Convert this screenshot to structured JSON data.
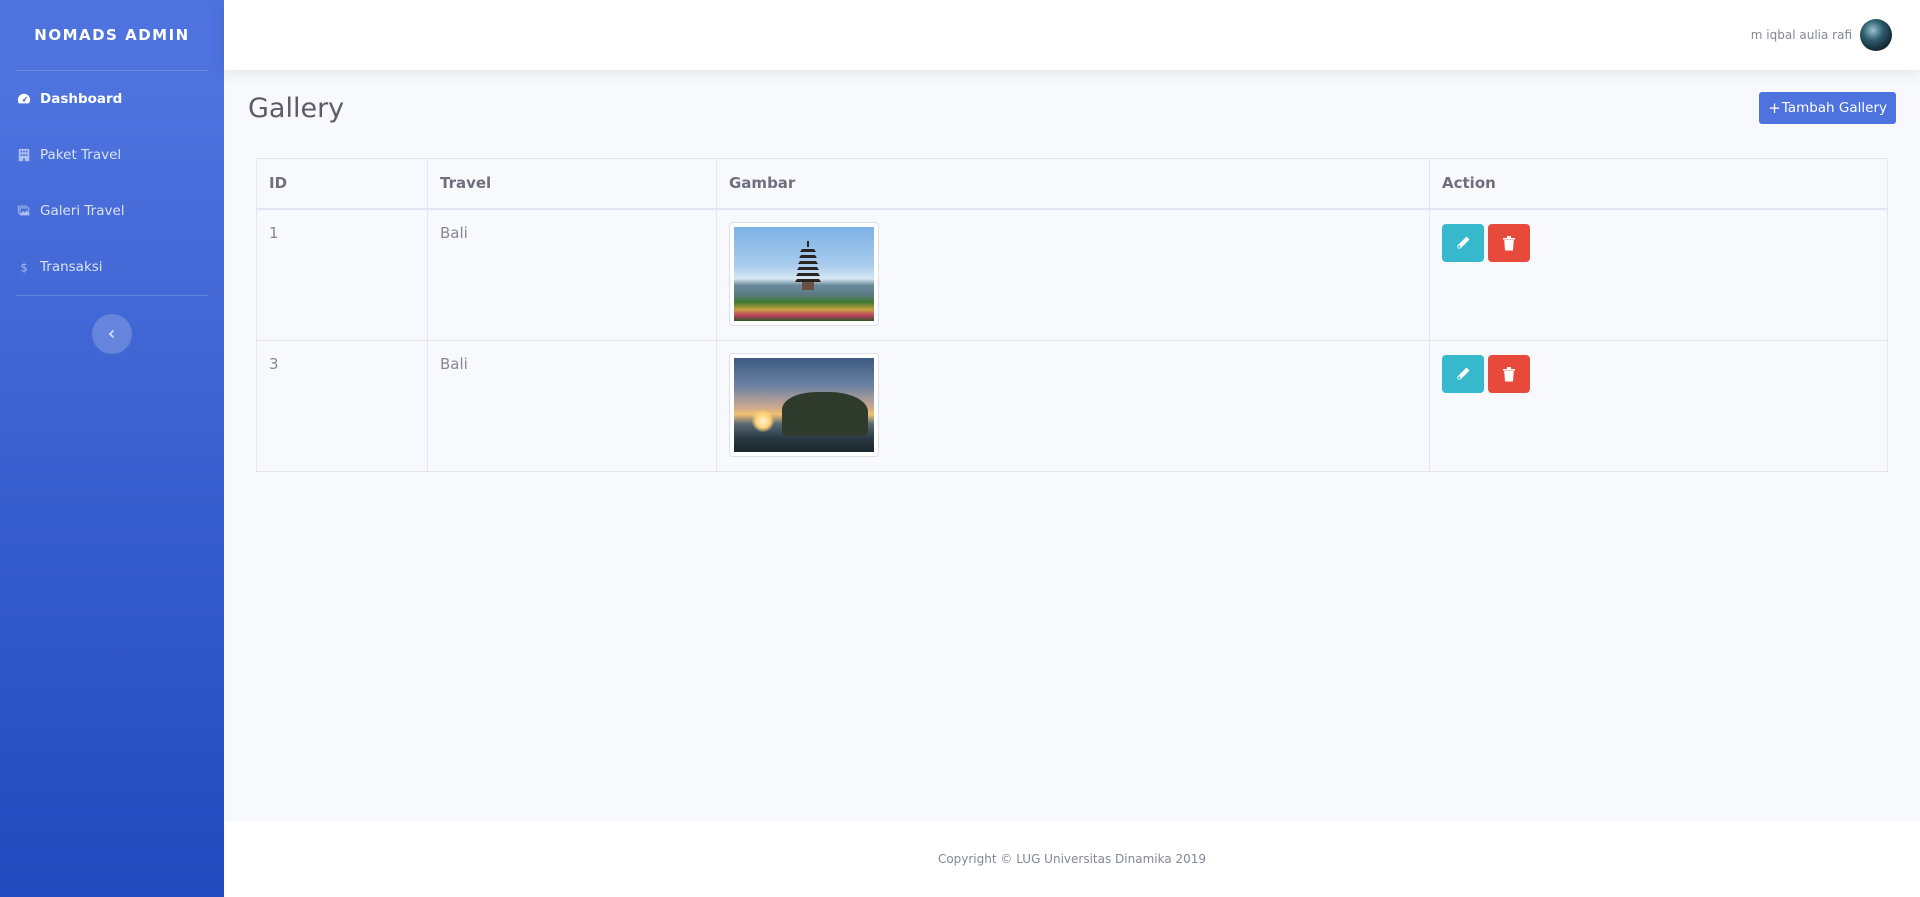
{
  "sidebar": {
    "brand": "NOMADS ADMIN",
    "items": [
      {
        "label": "Dashboard",
        "icon": "tachometer-icon",
        "active": true
      },
      {
        "label": "Paket Travel",
        "icon": "building-icon",
        "active": false
      },
      {
        "label": "Galeri Travel",
        "icon": "images-icon",
        "active": false
      },
      {
        "label": "Transaksi",
        "icon": "dollar-icon",
        "active": false
      }
    ],
    "toggle_icon": "chevron-left-icon"
  },
  "topbar": {
    "user_name": "m iqbal aulia rafi",
    "avatar_icon": "avatar"
  },
  "page": {
    "title": "Gallery",
    "add_button": "Tambah Gallery",
    "add_icon": "plus-icon"
  },
  "table": {
    "headers": [
      "ID",
      "Travel",
      "Gambar",
      "Action"
    ],
    "rows": [
      {
        "id": "1",
        "travel": "Bali",
        "image": "pagoda-lake-photo"
      },
      {
        "id": "3",
        "travel": "Bali",
        "image": "sea-temple-sunset-photo"
      }
    ]
  },
  "footer": {
    "copyright": "Copyright © LUG Universitas Dinamika 2019"
  },
  "colors": {
    "primary": "#4e73df",
    "info": "#36b9cc",
    "danger": "#e74a3b"
  }
}
